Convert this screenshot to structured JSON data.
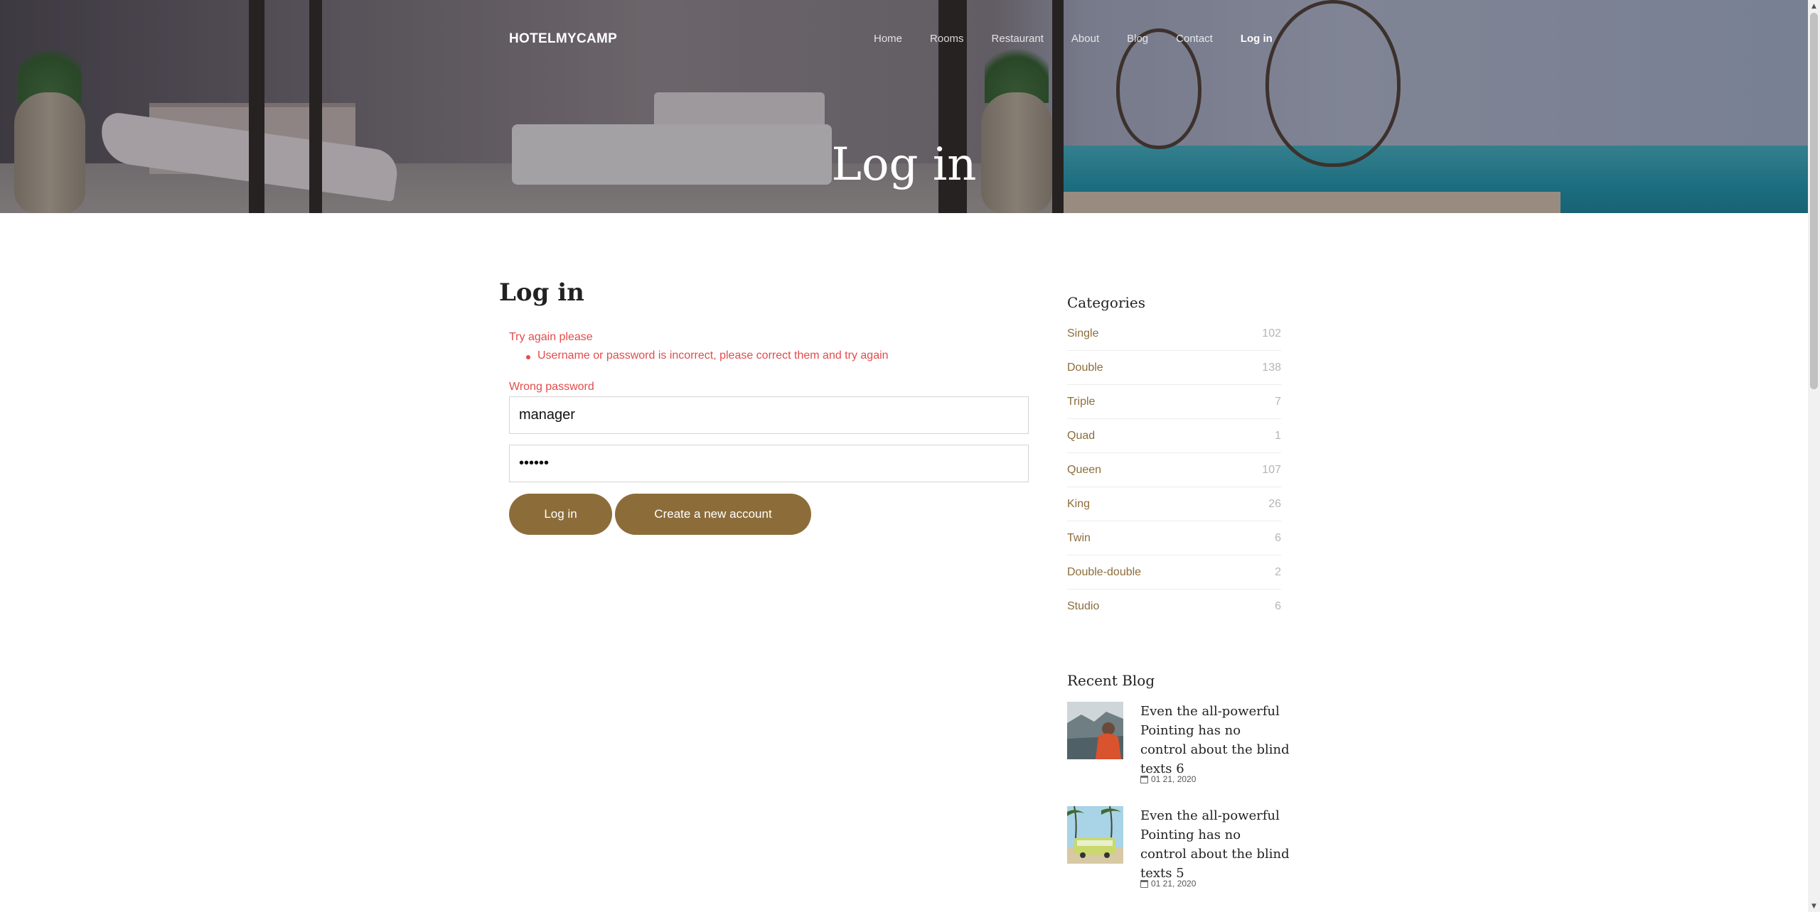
{
  "nav": {
    "brand": "HOTELMYCAMP",
    "items": [
      {
        "label": "Home"
      },
      {
        "label": "Rooms"
      },
      {
        "label": "Restaurant"
      },
      {
        "label": "About"
      },
      {
        "label": "Blog"
      },
      {
        "label": "Contact"
      },
      {
        "label": "Log in",
        "active": true
      }
    ]
  },
  "hero": {
    "title": "Log in"
  },
  "login": {
    "heading": "Log in",
    "error_title": "Try again please",
    "error_items": [
      "Username or password is incorrect, please correct them and try again"
    ],
    "field_error": "Wrong password",
    "username_value": "manager",
    "password_value": "••••••",
    "login_button": "Log in",
    "create_button": "Create a new account"
  },
  "sidebar": {
    "categories_heading": "Categories",
    "categories": [
      {
        "name": "Single",
        "count": "102"
      },
      {
        "name": "Double",
        "count": "138"
      },
      {
        "name": "Triple",
        "count": "7"
      },
      {
        "name": "Quad",
        "count": "1"
      },
      {
        "name": "Queen",
        "count": "107"
      },
      {
        "name": "King",
        "count": "26"
      },
      {
        "name": "Twin",
        "count": "6"
      },
      {
        "name": "Double-double",
        "count": "2"
      },
      {
        "name": "Studio",
        "count": "6"
      }
    ],
    "recent_heading": "Recent Blog",
    "recent": [
      {
        "title": "Even the all-powerful Pointing has no control about the blind texts 6",
        "date": "01 21, 2020"
      },
      {
        "title": "Even the all-powerful Pointing has no control about the blind texts 5",
        "date": "01 21, 2020"
      }
    ]
  },
  "colors": {
    "accent": "#8c6d3a",
    "error": "#e34b4b"
  }
}
